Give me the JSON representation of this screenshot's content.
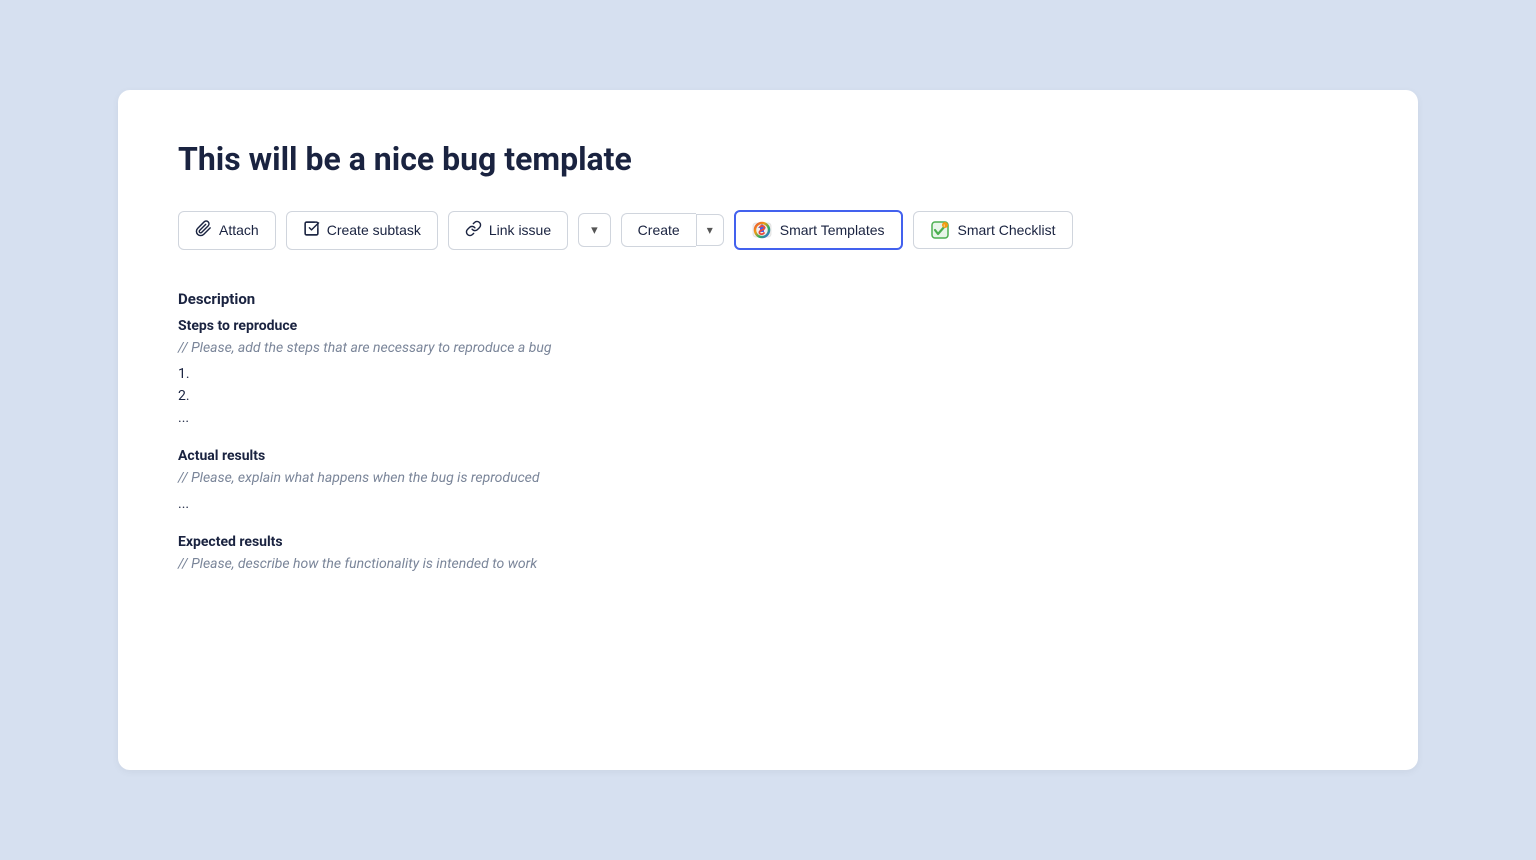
{
  "page": {
    "title": "This will be a nice bug template",
    "background_color": "#d6e0f0"
  },
  "toolbar": {
    "attach_label": "Attach",
    "create_subtask_label": "Create subtask",
    "link_issue_label": "Link issue",
    "chevron_symbol": "∨",
    "create_label": "Create",
    "smart_templates_label": "Smart Templates",
    "smart_checklist_label": "Smart Checklist"
  },
  "description": {
    "heading": "Description",
    "steps_heading": "Steps to reproduce",
    "steps_comment": "// Please, add the steps that are necessary to reproduce a bug",
    "step1": "1.",
    "step2": "2.",
    "steps_ellipsis": "...",
    "actual_heading": "Actual results",
    "actual_comment": "// Please, explain what happens when the bug is reproduced",
    "actual_ellipsis": "...",
    "expected_heading": "Expected results",
    "expected_comment": "// Please, describe how the functionality is intended to work"
  }
}
